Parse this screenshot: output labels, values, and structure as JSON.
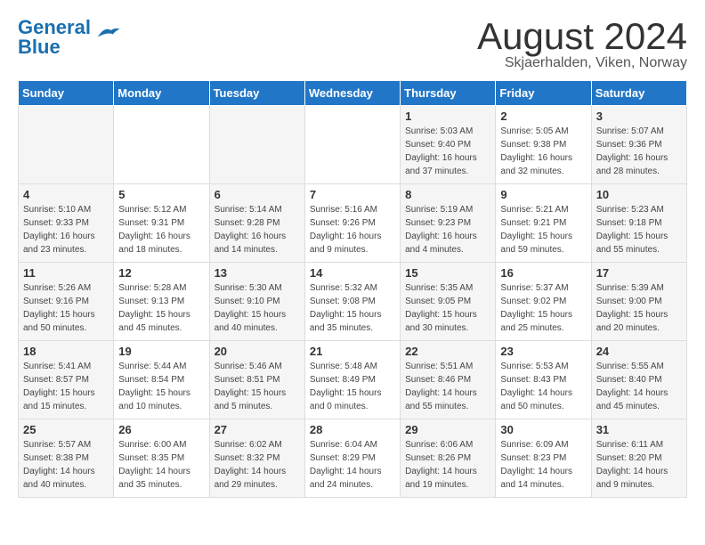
{
  "header": {
    "logo_line1": "General",
    "logo_line2": "Blue",
    "month_title": "August 2024",
    "location": "Skjaerhalden, Viken, Norway"
  },
  "weekdays": [
    "Sunday",
    "Monday",
    "Tuesday",
    "Wednesday",
    "Thursday",
    "Friday",
    "Saturday"
  ],
  "weeks": [
    {
      "days": [
        {
          "num": "",
          "info": ""
        },
        {
          "num": "",
          "info": ""
        },
        {
          "num": "",
          "info": ""
        },
        {
          "num": "",
          "info": ""
        },
        {
          "num": "1",
          "info": "Sunrise: 5:03 AM\nSunset: 9:40 PM\nDaylight: 16 hours\nand 37 minutes."
        },
        {
          "num": "2",
          "info": "Sunrise: 5:05 AM\nSunset: 9:38 PM\nDaylight: 16 hours\nand 32 minutes."
        },
        {
          "num": "3",
          "info": "Sunrise: 5:07 AM\nSunset: 9:36 PM\nDaylight: 16 hours\nand 28 minutes."
        }
      ]
    },
    {
      "days": [
        {
          "num": "4",
          "info": "Sunrise: 5:10 AM\nSunset: 9:33 PM\nDaylight: 16 hours\nand 23 minutes."
        },
        {
          "num": "5",
          "info": "Sunrise: 5:12 AM\nSunset: 9:31 PM\nDaylight: 16 hours\nand 18 minutes."
        },
        {
          "num": "6",
          "info": "Sunrise: 5:14 AM\nSunset: 9:28 PM\nDaylight: 16 hours\nand 14 minutes."
        },
        {
          "num": "7",
          "info": "Sunrise: 5:16 AM\nSunset: 9:26 PM\nDaylight: 16 hours\nand 9 minutes."
        },
        {
          "num": "8",
          "info": "Sunrise: 5:19 AM\nSunset: 9:23 PM\nDaylight: 16 hours\nand 4 minutes."
        },
        {
          "num": "9",
          "info": "Sunrise: 5:21 AM\nSunset: 9:21 PM\nDaylight: 15 hours\nand 59 minutes."
        },
        {
          "num": "10",
          "info": "Sunrise: 5:23 AM\nSunset: 9:18 PM\nDaylight: 15 hours\nand 55 minutes."
        }
      ]
    },
    {
      "days": [
        {
          "num": "11",
          "info": "Sunrise: 5:26 AM\nSunset: 9:16 PM\nDaylight: 15 hours\nand 50 minutes."
        },
        {
          "num": "12",
          "info": "Sunrise: 5:28 AM\nSunset: 9:13 PM\nDaylight: 15 hours\nand 45 minutes."
        },
        {
          "num": "13",
          "info": "Sunrise: 5:30 AM\nSunset: 9:10 PM\nDaylight: 15 hours\nand 40 minutes."
        },
        {
          "num": "14",
          "info": "Sunrise: 5:32 AM\nSunset: 9:08 PM\nDaylight: 15 hours\nand 35 minutes."
        },
        {
          "num": "15",
          "info": "Sunrise: 5:35 AM\nSunset: 9:05 PM\nDaylight: 15 hours\nand 30 minutes."
        },
        {
          "num": "16",
          "info": "Sunrise: 5:37 AM\nSunset: 9:02 PM\nDaylight: 15 hours\nand 25 minutes."
        },
        {
          "num": "17",
          "info": "Sunrise: 5:39 AM\nSunset: 9:00 PM\nDaylight: 15 hours\nand 20 minutes."
        }
      ]
    },
    {
      "days": [
        {
          "num": "18",
          "info": "Sunrise: 5:41 AM\nSunset: 8:57 PM\nDaylight: 15 hours\nand 15 minutes."
        },
        {
          "num": "19",
          "info": "Sunrise: 5:44 AM\nSunset: 8:54 PM\nDaylight: 15 hours\nand 10 minutes."
        },
        {
          "num": "20",
          "info": "Sunrise: 5:46 AM\nSunset: 8:51 PM\nDaylight: 15 hours\nand 5 minutes."
        },
        {
          "num": "21",
          "info": "Sunrise: 5:48 AM\nSunset: 8:49 PM\nDaylight: 15 hours\nand 0 minutes."
        },
        {
          "num": "22",
          "info": "Sunrise: 5:51 AM\nSunset: 8:46 PM\nDaylight: 14 hours\nand 55 minutes."
        },
        {
          "num": "23",
          "info": "Sunrise: 5:53 AM\nSunset: 8:43 PM\nDaylight: 14 hours\nand 50 minutes."
        },
        {
          "num": "24",
          "info": "Sunrise: 5:55 AM\nSunset: 8:40 PM\nDaylight: 14 hours\nand 45 minutes."
        }
      ]
    },
    {
      "days": [
        {
          "num": "25",
          "info": "Sunrise: 5:57 AM\nSunset: 8:38 PM\nDaylight: 14 hours\nand 40 minutes."
        },
        {
          "num": "26",
          "info": "Sunrise: 6:00 AM\nSunset: 8:35 PM\nDaylight: 14 hours\nand 35 minutes."
        },
        {
          "num": "27",
          "info": "Sunrise: 6:02 AM\nSunset: 8:32 PM\nDaylight: 14 hours\nand 29 minutes."
        },
        {
          "num": "28",
          "info": "Sunrise: 6:04 AM\nSunset: 8:29 PM\nDaylight: 14 hours\nand 24 minutes."
        },
        {
          "num": "29",
          "info": "Sunrise: 6:06 AM\nSunset: 8:26 PM\nDaylight: 14 hours\nand 19 minutes."
        },
        {
          "num": "30",
          "info": "Sunrise: 6:09 AM\nSunset: 8:23 PM\nDaylight: 14 hours\nand 14 minutes."
        },
        {
          "num": "31",
          "info": "Sunrise: 6:11 AM\nSunset: 8:20 PM\nDaylight: 14 hours\nand 9 minutes."
        }
      ]
    }
  ]
}
